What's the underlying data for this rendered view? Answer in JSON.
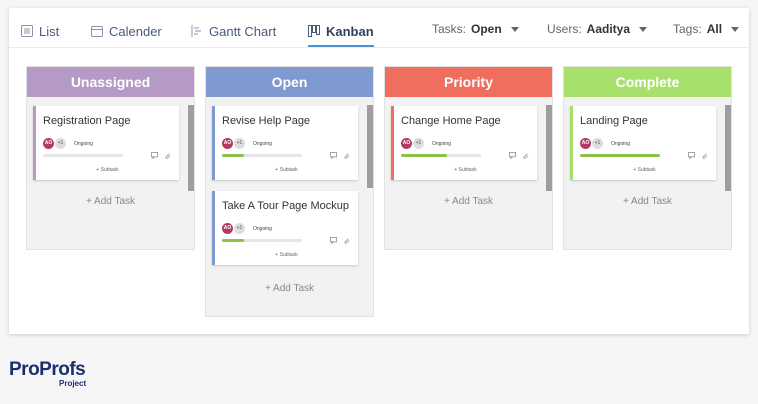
{
  "views": [
    {
      "label": "List",
      "icon": "list-icon"
    },
    {
      "label": "Calender",
      "icon": "calendar-icon"
    },
    {
      "label": "Gantt Chart",
      "icon": "gantt-icon"
    },
    {
      "label": "Kanban",
      "icon": "kanban-icon",
      "active": true
    }
  ],
  "filters": {
    "tasks": {
      "label": "Tasks:",
      "value": "Open"
    },
    "users": {
      "label": "Users:",
      "value": "Aaditya"
    },
    "tags": {
      "label": "Tags:",
      "value": "All"
    }
  },
  "columns": [
    {
      "title": "Unassigned",
      "color": "#b59ac7",
      "border": "#b59ac7",
      "cards": [
        {
          "title": "Registration Page",
          "avatar": "AO",
          "more": "+1",
          "status": "Ongoing",
          "progress": 0,
          "subtask": "+ Subtask"
        }
      ],
      "add_task": "+ Add Task"
    },
    {
      "title": "Open",
      "color": "#7e9ad0",
      "border": "#7e9ad0",
      "cards": [
        {
          "title": "Revise Help Page",
          "avatar": "AO",
          "more": "+1",
          "status": "Ongoing",
          "progress": 0.27,
          "subtask": "+ Subtask"
        },
        {
          "title": "Take A Tour Page Mockup",
          "avatar": "AO",
          "more": "+1",
          "status": "Ongoing",
          "progress": 0.27,
          "subtask": "+ Subtask"
        }
      ],
      "add_task": "+ Add Task"
    },
    {
      "title": "Priority",
      "color": "#f06e5e",
      "border": "#f06e5e",
      "cards": [
        {
          "title": "Change Home Page",
          "avatar": "AO",
          "more": "+1",
          "status": "Ongoing",
          "progress": 0.58,
          "subtask": "+ Subtask"
        }
      ],
      "add_task": "+ Add Task"
    },
    {
      "title": "Complete",
      "color": "#a8e06e",
      "border": "#a8e06e",
      "cards": [
        {
          "title": "Landing Page",
          "avatar": "AO",
          "more": "+1",
          "status": "Ongoing",
          "progress": 1.0,
          "subtask": "+ Subtask"
        }
      ],
      "add_task": "+ Add Task"
    }
  ],
  "brand": {
    "main": "ProProfs",
    "sub": "Project"
  }
}
